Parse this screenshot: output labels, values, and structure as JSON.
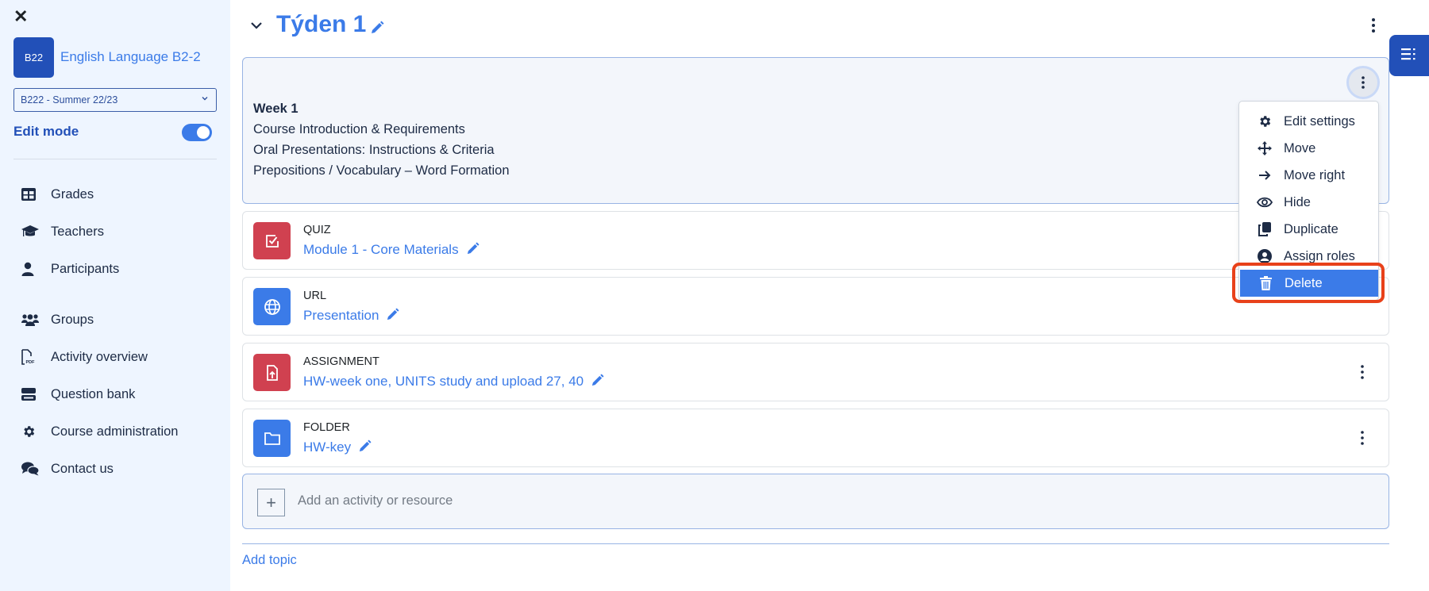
{
  "sidebar": {
    "close_label": "✕",
    "course_badge": "B22",
    "course_name": "English Language B2-2",
    "course_select": {
      "value": "B222 - Summer 22/23"
    },
    "edit_mode_label": "Edit mode",
    "edit_mode_on": true,
    "items": [
      {
        "label": "Grades",
        "icon": "grades-table-icon"
      },
      {
        "label": "Teachers",
        "icon": "graduation-cap-icon"
      },
      {
        "label": "Participants",
        "icon": "user-icon"
      },
      {
        "label": "Groups",
        "icon": "users-group-icon"
      },
      {
        "label": "Activity overview",
        "icon": "pdf-file-icon"
      },
      {
        "label": "Question bank",
        "icon": "database-icon"
      },
      {
        "label": "Course administration",
        "icon": "gear-icon"
      },
      {
        "label": "Contact us",
        "icon": "comments-icon"
      }
    ]
  },
  "section": {
    "title": "Týden 1",
    "summary": {
      "heading": "Week 1",
      "lines": [
        "Course Introduction & Requirements",
        "Oral Presentations: Instructions & Criteria",
        "Prepositions / Vocabulary – Word Formation"
      ]
    },
    "activities": [
      {
        "type": "QUIZ",
        "name": "Module 1 - Core Materials",
        "icon": "quiz-check-icon",
        "color": "#d04150"
      },
      {
        "type": "URL",
        "name": "Presentation",
        "icon": "globe-icon",
        "color": "#3b7be8"
      },
      {
        "type": "ASSIGNMENT",
        "name": "HW-week one, UNITS study and upload 27, 40",
        "icon": "file-upload-icon",
        "color": "#d04150"
      },
      {
        "type": "FOLDER",
        "name": "HW-key",
        "icon": "folder-icon",
        "color": "#3b7be8"
      }
    ],
    "add_activity_label": "Add an activity or resource",
    "add_topic_label": "Add topic"
  },
  "dropdown_menu": {
    "items": [
      {
        "label": "Edit settings",
        "icon": "gear-icon"
      },
      {
        "label": "Move",
        "icon": "move-arrows-icon"
      },
      {
        "label": "Move right",
        "icon": "arrow-right-icon"
      },
      {
        "label": "Hide",
        "icon": "eye-icon"
      },
      {
        "label": "Duplicate",
        "icon": "copy-icon"
      },
      {
        "label": "Assign roles",
        "icon": "user-circle-icon"
      },
      {
        "label": "Delete",
        "icon": "trash-icon",
        "highlighted": true
      }
    ]
  },
  "colors": {
    "brand_dark": "#2250b8",
    "link_blue": "#3b7be8",
    "sidebar_bg": "#eef5ff",
    "highlight_ring": "#e8411a",
    "danger_red": "#d04150"
  }
}
